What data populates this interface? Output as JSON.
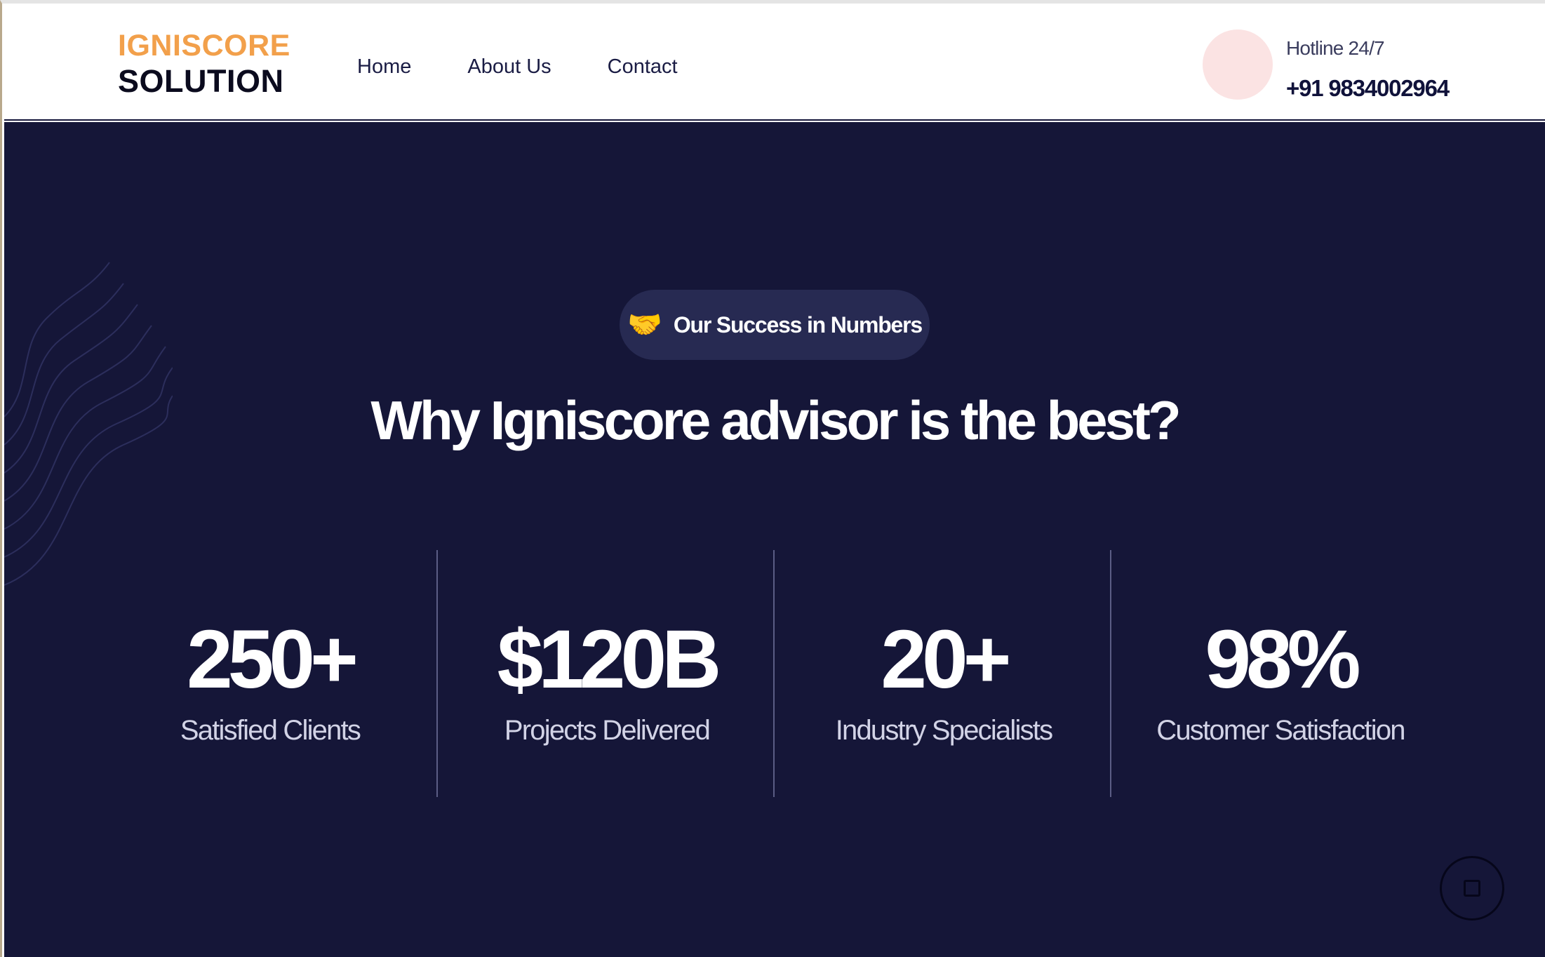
{
  "colors": {
    "brand_orange": "#f2a04b",
    "hero_background": "#151638",
    "pill_background": "#272a52",
    "hotline_circle": "#fbe3e3",
    "stat_value": "#ffffff",
    "stat_label": "#d2d3e6"
  },
  "header": {
    "logo_line1": "IGNISCORE",
    "logo_line2": "SOLUTION",
    "nav": [
      {
        "label": "Home"
      },
      {
        "label": "About Us"
      },
      {
        "label": "Contact"
      }
    ],
    "hotline": {
      "label": "Hotline 24/7",
      "number": "+91 9834002964",
      "icon": "phone-circle-icon"
    }
  },
  "hero": {
    "badge": {
      "icon": "handshake-icon",
      "glyph": "🤝",
      "text": "Our Success in Numbers"
    },
    "headline": "Why Igniscore advisor is the best?",
    "stats": [
      {
        "value": "250+",
        "label": "Satisfied Clients"
      },
      {
        "value": "$120B",
        "label": "Projects Delivered"
      },
      {
        "value": "20+",
        "label": "Industry Specialists"
      },
      {
        "value": "98%",
        "label": "Customer Satisfaction"
      }
    ],
    "scroll_button_icon": "square-icon"
  }
}
